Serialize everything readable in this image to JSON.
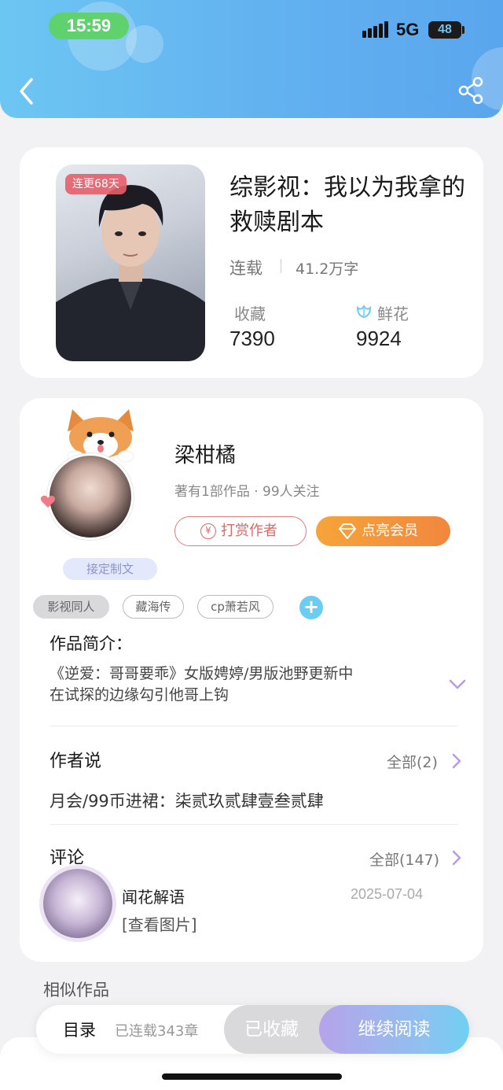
{
  "status_bar": {
    "time": "15:59",
    "network": "5G",
    "battery": "48"
  },
  "book": {
    "badge": "连更68天",
    "title": "综影视：我以为我拿的救赎剧本",
    "status": "连载",
    "word_count": "41.2万字",
    "favorites_label": "收藏",
    "favorites_value": "7390",
    "flowers_label": "鲜花",
    "flowers_value": "9924"
  },
  "author": {
    "name": "梁柑橘",
    "meta": "著有1部作品 · 99人关注",
    "custom_tag": "接定制文",
    "tip_label": "打赏作者",
    "vip_label": "点亮会员"
  },
  "tags": [
    "影视同人",
    "藏海传",
    "cp萧若风"
  ],
  "intro": {
    "title": "作品简介：",
    "line1": "《逆爱：哥哥要乖》女版娉婷/男版池野更新中",
    "line2": "在试探的边缘勾引他哥上钩"
  },
  "author_says": {
    "title": "作者说",
    "more": "全部(2)",
    "text": "月会/99币进裙：柒贰玖贰肆壹叁贰肆"
  },
  "comments": {
    "title": "评论",
    "more": "全部(147)",
    "user": "闻花解语",
    "date": "2025-07-04",
    "text": "[查看图片]"
  },
  "similar_title": "相似作品",
  "bottom_bar": {
    "toc": "目录",
    "chapters": "已连载343章",
    "collected": "已收藏",
    "continue": "继续阅读"
  },
  "colors": {
    "header_gradient_start": "#6cc6f2",
    "header_gradient_end": "#5aa6ee",
    "time_pill": "#5fd26d",
    "tip_red": "#d86a6a",
    "vip_orange": "#f2873e",
    "read_gradient_start": "#b6a3ea",
    "read_gradient_end": "#6fd0f3"
  },
  "icons": [
    "back-chevron",
    "share",
    "flower",
    "coin",
    "diamond",
    "plus",
    "chevron-down",
    "chevron-right"
  ]
}
